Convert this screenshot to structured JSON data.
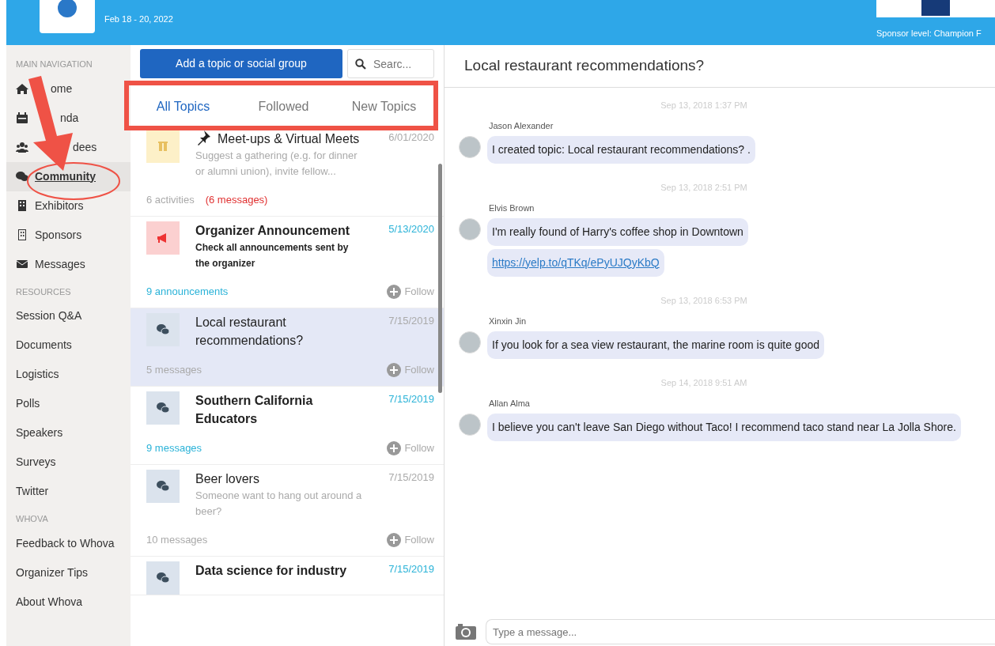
{
  "header": {
    "date": "Feb 18 - 20, 2022",
    "sponsor_level": "Sponsor level: Champion F"
  },
  "sidebar": {
    "sections": [
      {
        "heading": "MAIN NAVIGATION",
        "items": [
          {
            "label": "ome",
            "selected": false
          },
          {
            "label": "nda",
            "selected": false
          },
          {
            "label": "dees",
            "selected": false
          },
          {
            "label": "Community",
            "selected": true
          },
          {
            "label": "Exhibitors",
            "selected": false
          },
          {
            "label": "Sponsors",
            "selected": false
          },
          {
            "label": "Messages",
            "selected": false
          }
        ]
      },
      {
        "heading": "RESOURCES",
        "items": [
          {
            "label": "Session Q&A",
            "selected": false
          },
          {
            "label": "Documents",
            "selected": false
          },
          {
            "label": "Logistics",
            "selected": false
          },
          {
            "label": "Polls",
            "selected": false
          },
          {
            "label": "Speakers",
            "selected": false
          },
          {
            "label": "Surveys",
            "selected": false
          },
          {
            "label": "Twitter",
            "selected": false
          }
        ]
      },
      {
        "heading": "WHOVA",
        "items": [
          {
            "label": "Feedback to Whova",
            "selected": false
          },
          {
            "label": "Organizer Tips",
            "selected": false
          },
          {
            "label": "About Whova",
            "selected": false
          }
        ]
      }
    ]
  },
  "topics": {
    "add_button": "Add a topic or social group",
    "search": {
      "placeholder": "Searc..."
    },
    "tabs": [
      {
        "label": "All Topics",
        "selected": true
      },
      {
        "label": "Followed",
        "selected": false
      },
      {
        "label": "New Topics",
        "selected": false
      }
    ],
    "items": [
      {
        "kind": "pinned",
        "title": "Meet-ups & Virtual Meets",
        "description": "Suggest a gathering (e.g. for dinner or alumni union), invite fellow...",
        "date": "6/01/2020",
        "footer": "6 activities",
        "footer_extra": "(6 messages)",
        "unread": false,
        "selected": false
      },
      {
        "kind": "announcement",
        "title": "Organizer Announcement",
        "description": "Check all announcements sent by the organizer",
        "date": "5/13/2020",
        "footer": "9 announcements",
        "follow": "Follow",
        "unread": true,
        "selected": false
      },
      {
        "kind": "group",
        "title": "Local restaurant recommendations?",
        "date": "7/15/2019",
        "footer": "5 messages",
        "follow": "Follow",
        "unread": false,
        "selected": true
      },
      {
        "kind": "group",
        "title": "Southern California Educators",
        "date": "7/15/2019",
        "footer": "9 messages",
        "follow": "Follow",
        "unread": true,
        "selected": false
      },
      {
        "kind": "group",
        "title": "Beer lovers",
        "description": "Someone want to hang out around a beer?",
        "date": "7/15/2019",
        "footer": "10 messages",
        "follow": "Follow",
        "unread": false,
        "selected": false
      },
      {
        "kind": "group",
        "title": "Data science for industry",
        "date": "7/15/2019",
        "unread": true,
        "selected": false
      }
    ]
  },
  "chat": {
    "title": "Local restaurant recommendations?",
    "messages": [
      {
        "time": "Sep 13, 2018 1:37 PM",
        "author": "Jason Alexander",
        "bubbles": [
          {
            "kind": "text",
            "text": "I created topic: Local restaurant recommendations? ."
          }
        ]
      },
      {
        "time": "Sep 13, 2018 2:51 PM",
        "author": "Elvis Brown",
        "bubbles": [
          {
            "kind": "text",
            "text": "I'm really found of Harry's coffee shop in Downtown"
          },
          {
            "kind": "link",
            "text": "https://yelp.to/qTKq/ePyUJQyKbQ"
          }
        ]
      },
      {
        "time": "Sep 13, 2018 6:53 PM",
        "author": "Xinxin Jin",
        "bubbles": [
          {
            "kind": "text",
            "text": "If you look for a sea view restaurant, the marine room is quite good"
          }
        ]
      },
      {
        "time": "Sep 14, 2018 9:51 AM",
        "author": "Allan Alma",
        "bubbles": [
          {
            "kind": "text",
            "text": "I believe you can't leave San Diego without Taco! I recommend taco stand near La Jolla Shore."
          }
        ]
      }
    ],
    "composer": {
      "placeholder": "Type a message..."
    }
  }
}
